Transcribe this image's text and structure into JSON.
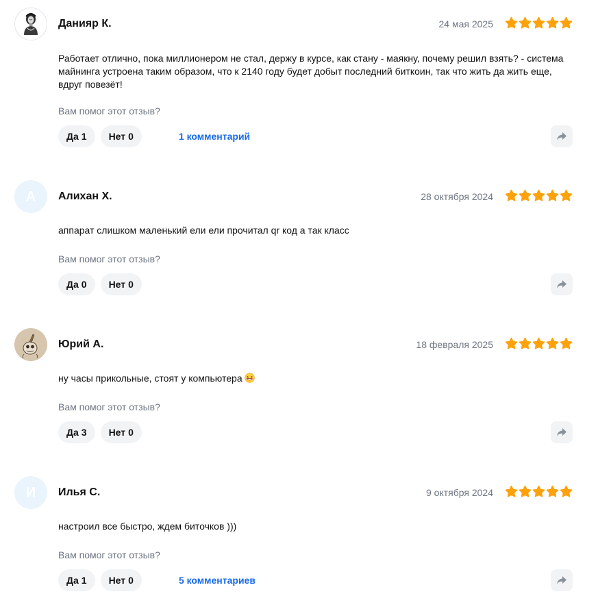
{
  "reviews": [
    {
      "author": "Данияр К.",
      "date": "24 мая 2025",
      "rating": 5,
      "avatar": {
        "type": "photo",
        "icon": "statue-avatar-icon"
      },
      "text": "Работает отлично, пока миллионером не стал, держу в курсе, как стану - маякну, почему решил взять? - система майнинга устроена таким образом, что к 2140 году будет добыт последний биткоин, так что жить да жить еще, вдруг повезёт!",
      "helpful_question": "Вам помог этот отзыв?",
      "yes_label": "Да",
      "yes_count": "1",
      "no_label": "Нет",
      "no_count": "0",
      "comments": "1 комментарий"
    },
    {
      "author": "Алихан Х.",
      "date": "28 октября 2024",
      "rating": 5,
      "avatar": {
        "type": "letter",
        "letter": "А"
      },
      "text": "аппарат слишком маленький ели ели прочитал qr код а так класс",
      "helpful_question": "Вам помог этот отзыв?",
      "yes_label": "Да",
      "yes_count": "0",
      "no_label": "Нет",
      "no_count": "0"
    },
    {
      "author": "Юрий А.",
      "date": "18 февраля 2025",
      "rating": 5,
      "avatar": {
        "type": "photo",
        "icon": "cartoon-avatar-icon"
      },
      "text": "ну часы прикольные, стоят у компьютера",
      "text_emoji": "grinning-face-emoji",
      "helpful_question": "Вам помог этот отзыв?",
      "yes_label": "Да",
      "yes_count": "3",
      "no_label": "Нет",
      "no_count": "0"
    },
    {
      "author": "Илья С.",
      "date": "9 октября 2024",
      "rating": 5,
      "avatar": {
        "type": "letter",
        "letter": "И"
      },
      "text": "настроил все быстро, ждем биточков )))",
      "helpful_question": "Вам помог этот отзыв?",
      "yes_label": "Да",
      "yes_count": "1",
      "no_label": "Нет",
      "no_count": "0",
      "comments": "5 комментариев"
    }
  ],
  "colors": {
    "star": "#ffa10a",
    "link": "#1a6be8",
    "muted_text": "#6e7480",
    "button_bg": "#f2f3f5",
    "letter_avatar_bg": "#eaf4fc"
  },
  "icons": {
    "star": "star-icon",
    "share": "share-arrow-icon"
  }
}
